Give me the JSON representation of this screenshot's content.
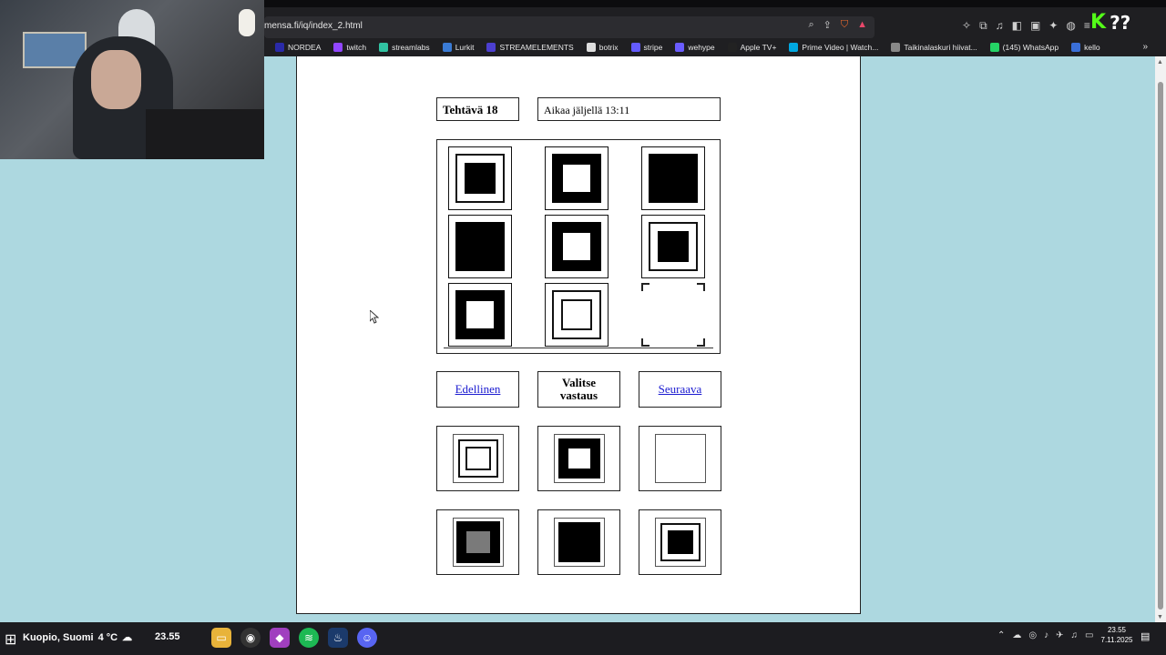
{
  "browser": {
    "url": "mensa.fi/iq/index_2.html",
    "bookmarks": [
      {
        "label": "NORDEA",
        "color": "#2a2aa8"
      },
      {
        "label": "twitch",
        "color": "#9146ff"
      },
      {
        "label": "streamlabs",
        "color": "#31c3a2"
      },
      {
        "label": "Lurkit",
        "color": "#3a7bd5"
      },
      {
        "label": "STREAMELEMENTS",
        "color": "#4c3fd0"
      },
      {
        "label": "botrix",
        "color": "#dddddd"
      },
      {
        "label": "stripe",
        "color": "#635bff"
      },
      {
        "label": "wehype",
        "color": "#6a5cff"
      },
      {
        "label": "Apple TV+",
        "color": "#222222"
      },
      {
        "label": "Prime Video | Watch...",
        "color": "#00a8e1"
      },
      {
        "label": "Taikinalaskuri hiivat...",
        "color": "#888888"
      },
      {
        "label": "(145) WhatsApp",
        "color": "#25d366"
      },
      {
        "label": "kello",
        "color": "#3a6fd8"
      }
    ],
    "overlay": {
      "k": "K",
      "q": "??"
    }
  },
  "quiz": {
    "task_label": "Tehtävä 18",
    "time_label": "Aikaa jäljellä 13:11",
    "prev_label": "Edellinen",
    "choose_line1": "Valitse",
    "choose_line2": "vastaus",
    "next_label": "Seuraava"
  },
  "taskbar": {
    "weather": "Kuopio, Suomi",
    "temp": "4 °C",
    "clock_left": "23.55",
    "time": "23.55",
    "date": "7.11.2025"
  },
  "colors": {
    "background": "#add8e0",
    "page": "#ffffff",
    "link": "#1a1ad0"
  }
}
